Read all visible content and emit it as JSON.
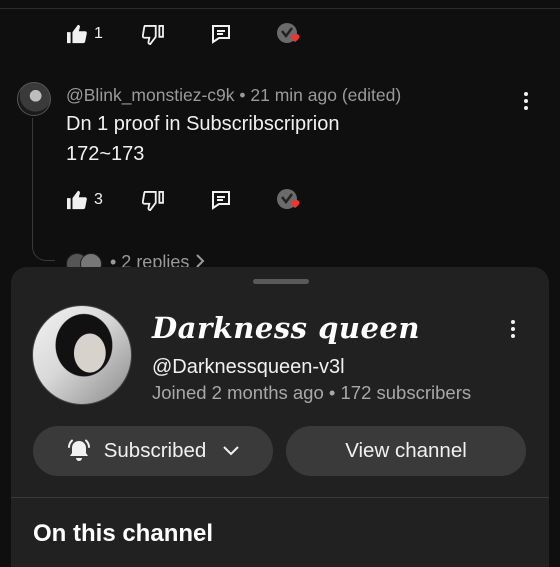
{
  "comment_top": {
    "like_count": "1"
  },
  "comment": {
    "author_meta": "@Blink_monstiez-c9k • 21 min ago (edited)",
    "text_line1": "Dn 1 proof in Subscribscriprion",
    "text_line2": "172~173",
    "like_count": "3",
    "replies_label": "• 2 replies"
  },
  "channel_sheet": {
    "name": "Darkness queen",
    "handle": "@Darknessqueen-v3l",
    "joined": "Joined 2 months ago • 172 subscribers",
    "subscribed_label": "Subscribed",
    "view_channel_label": "View channel",
    "section_title": "On this channel"
  },
  "icons": {
    "like": "thumbs-up-icon",
    "dislike": "thumbs-down-icon",
    "reply": "reply-icon",
    "creator_heart": "heart-badge-icon",
    "more": "more-vertical-icon",
    "bell": "bell-icon",
    "chevron": "chevron-down-icon"
  },
  "colors": {
    "background": "#0f0f0f",
    "sheet": "#212121",
    "button": "#3a3a3a",
    "heart": "#e53935",
    "secondary_text": "#9a9a9a"
  }
}
